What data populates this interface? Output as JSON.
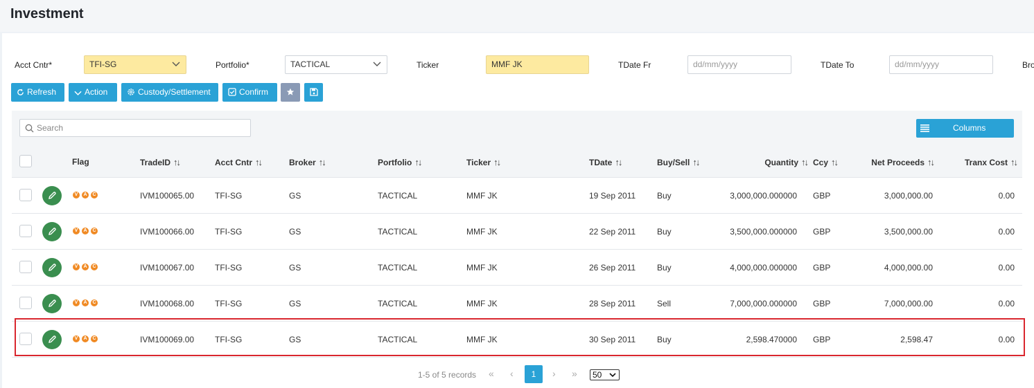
{
  "page": {
    "title": "Investment"
  },
  "filters": {
    "acct_cntr_label": "Acct Cntr*",
    "acct_cntr_value": "TFI-SG",
    "portfolio_label": "Portfolio*",
    "portfolio_value": "TACTICAL",
    "ticker_label": "Ticker",
    "ticker_value": "MMF JK",
    "tdate_fr_label": "TDate Fr",
    "tdate_fr_placeholder": "dd/mm/yyyy",
    "tdate_to_label": "TDate To",
    "tdate_to_placeholder": "dd/mm/yyyy",
    "broker_label_partial": "Bro"
  },
  "toolbar": {
    "refresh_label": "Refresh",
    "action_label": "Action",
    "custody_label": "Custody/Settlement",
    "confirm_label": "Confirm",
    "favorite_icon": "star-icon",
    "save_icon": "save-icon"
  },
  "grid": {
    "search_placeholder": "Search",
    "columns_label": "Columns",
    "headers": {
      "flag": "Flag",
      "trade_id": "TradeID",
      "acct_cntr": "Acct Cntr",
      "broker": "Broker",
      "portfolio": "Portfolio",
      "ticker": "Ticker",
      "tdate": "TDate",
      "buy_sell": "Buy/Sell",
      "quantity": "Quantity",
      "ccy": "Ccy",
      "net_proceeds": "Net Proceeds",
      "tranx_cost": "Tranx Cost"
    },
    "flag_letters": [
      "V",
      "A",
      "C"
    ],
    "rows": [
      {
        "trade_id": "IVM100065.00",
        "acct_cntr": "TFI-SG",
        "broker": "GS",
        "portfolio": "TACTICAL",
        "ticker": "MMF JK",
        "tdate": "19 Sep 2011",
        "buy_sell": "Buy",
        "quantity": "3,000,000.000000",
        "ccy": "GBP",
        "net_proceeds": "3,000,000.00",
        "tranx_cost": "0.00"
      },
      {
        "trade_id": "IVM100066.00",
        "acct_cntr": "TFI-SG",
        "broker": "GS",
        "portfolio": "TACTICAL",
        "ticker": "MMF JK",
        "tdate": "22 Sep 2011",
        "buy_sell": "Buy",
        "quantity": "3,500,000.000000",
        "ccy": "GBP",
        "net_proceeds": "3,500,000.00",
        "tranx_cost": "0.00"
      },
      {
        "trade_id": "IVM100067.00",
        "acct_cntr": "TFI-SG",
        "broker": "GS",
        "portfolio": "TACTICAL",
        "ticker": "MMF JK",
        "tdate": "26 Sep 2011",
        "buy_sell": "Buy",
        "quantity": "4,000,000.000000",
        "ccy": "GBP",
        "net_proceeds": "4,000,000.00",
        "tranx_cost": "0.00"
      },
      {
        "trade_id": "IVM100068.00",
        "acct_cntr": "TFI-SG",
        "broker": "GS",
        "portfolio": "TACTICAL",
        "ticker": "MMF JK",
        "tdate": "28 Sep 2011",
        "buy_sell": "Sell",
        "quantity": "7,000,000.000000",
        "ccy": "GBP",
        "net_proceeds": "7,000,000.00",
        "tranx_cost": "0.00"
      },
      {
        "trade_id": "IVM100069.00",
        "acct_cntr": "TFI-SG",
        "broker": "GS",
        "portfolio": "TACTICAL",
        "ticker": "MMF JK",
        "tdate": "30 Sep 2011",
        "buy_sell": "Buy",
        "quantity": "2,598.470000",
        "ccy": "GBP",
        "net_proceeds": "2,598.47",
        "tranx_cost": "0.00"
      }
    ]
  },
  "pagination": {
    "info": "1-5 of 5 records",
    "first": "«",
    "prev": "‹",
    "current": "1",
    "next": "›",
    "last": "»",
    "page_size": "50"
  },
  "colors": {
    "accent": "#2aa2d6",
    "edit_button": "#3a8e4f",
    "flag": "#f08a24",
    "highlight": "#d9262e",
    "input_highlight": "#fdeaa0"
  }
}
